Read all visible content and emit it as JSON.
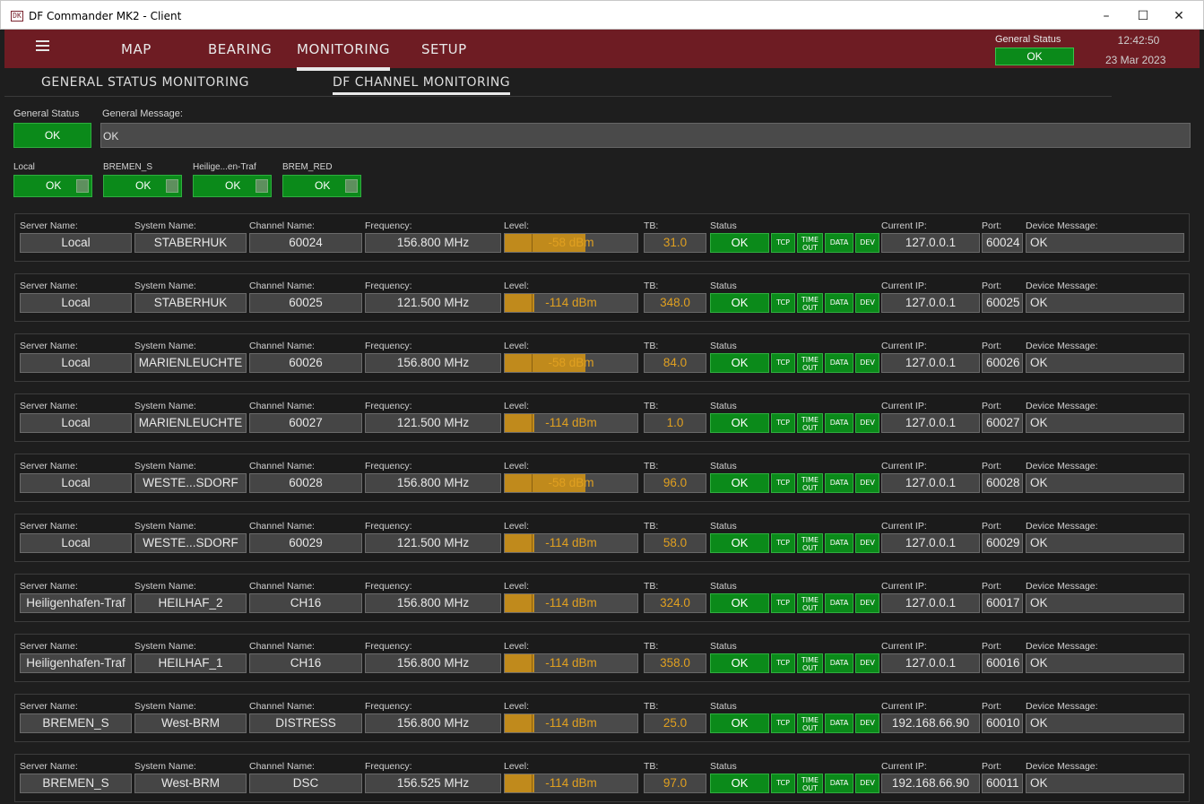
{
  "window": {
    "title": "DF Commander MK2 - Client",
    "icon_text": "DK"
  },
  "nav": {
    "items": [
      "MAP",
      "BEARING",
      "MONITORING",
      "SETUP"
    ],
    "active": "MONITORING"
  },
  "header_status": {
    "label": "General Status",
    "value": "OK",
    "time": "12:42:50",
    "date": "23 Mar 2023"
  },
  "subtabs": {
    "general": "GENERAL STATUS MONITORING",
    "channel": "DF CHANNEL MONITORING"
  },
  "general": {
    "status_label": "General Status",
    "status_value": "OK",
    "message_label": "General Message:",
    "message_value": "OK"
  },
  "servers": [
    {
      "name": "Local",
      "status": "OK"
    },
    {
      "name": "BREMEN_S",
      "status": "OK"
    },
    {
      "name": "Heilige...en-Traf",
      "status": "OK"
    },
    {
      "name": "BREM_RED",
      "status": "OK"
    }
  ],
  "labels": {
    "server": "Server Name:",
    "system": "System Name:",
    "channel": "Channel Name:",
    "frequency": "Frequency:",
    "level": "Level:",
    "tb": "TB:",
    "status": "Status",
    "ip": "Current IP:",
    "port": "Port:",
    "device": "Device Message:"
  },
  "flags": {
    "tcp": "TCP",
    "timeout_1": "TIME",
    "timeout_2": "OUT",
    "data": "DATA",
    "dev": "DEV"
  },
  "colors": {
    "title_bar": "#6e1c23",
    "ok_green": "#0b8a1a",
    "level_amber": "#c08a1c",
    "level_text": "#e0a020"
  },
  "channels": [
    {
      "server": "Local",
      "system": "STABERHUK",
      "channel": "60024",
      "frequency": "156.800 MHz",
      "level": "-58 dBm",
      "level_pct": 61,
      "tb": "31.0",
      "status": "OK",
      "ip": "127.0.0.1",
      "port": "60024",
      "message": "OK"
    },
    {
      "server": "Local",
      "system": "STABERHUK",
      "channel": "60025",
      "frequency": "121.500 MHz",
      "level": "-114 dBm",
      "level_pct": 22,
      "tb": "348.0",
      "status": "OK",
      "ip": "127.0.0.1",
      "port": "60025",
      "message": "OK"
    },
    {
      "server": "Local",
      "system": "MARIENLEUCHTE",
      "channel": "60026",
      "frequency": "156.800 MHz",
      "level": "-58 dBm",
      "level_pct": 61,
      "tb": "84.0",
      "status": "OK",
      "ip": "127.0.0.1",
      "port": "60026",
      "message": "OK"
    },
    {
      "server": "Local",
      "system": "MARIENLEUCHTE",
      "channel": "60027",
      "frequency": "121.500 MHz",
      "level": "-114 dBm",
      "level_pct": 22,
      "tb": "1.0",
      "status": "OK",
      "ip": "127.0.0.1",
      "port": "60027",
      "message": "OK"
    },
    {
      "server": "Local",
      "system": "WESTE...SDORF",
      "channel": "60028",
      "frequency": "156.800 MHz",
      "level": "-58 dBm",
      "level_pct": 61,
      "tb": "96.0",
      "status": "OK",
      "ip": "127.0.0.1",
      "port": "60028",
      "message": "OK"
    },
    {
      "server": "Local",
      "system": "WESTE...SDORF",
      "channel": "60029",
      "frequency": "121.500 MHz",
      "level": "-114 dBm",
      "level_pct": 22,
      "tb": "58.0",
      "status": "OK",
      "ip": "127.0.0.1",
      "port": "60029",
      "message": "OK"
    },
    {
      "server": "Heiligenhafen-Traf",
      "system": "HEILHAF_2",
      "channel": "CH16",
      "frequency": "156.800 MHz",
      "level": "-114 dBm",
      "level_pct": 22,
      "tb": "324.0",
      "status": "OK",
      "ip": "127.0.0.1",
      "port": "60017",
      "message": "OK"
    },
    {
      "server": "Heiligenhafen-Traf",
      "system": "HEILHAF_1",
      "channel": "CH16",
      "frequency": "156.800 MHz",
      "level": "-114 dBm",
      "level_pct": 22,
      "tb": "358.0",
      "status": "OK",
      "ip": "127.0.0.1",
      "port": "60016",
      "message": "OK"
    },
    {
      "server": "BREMEN_S",
      "system": "West-BRM",
      "channel": "DISTRESS",
      "frequency": "156.800 MHz",
      "level": "-114 dBm",
      "level_pct": 22,
      "tb": "25.0",
      "status": "OK",
      "ip": "192.168.66.90",
      "port": "60010",
      "message": "OK"
    },
    {
      "server": "BREMEN_S",
      "system": "West-BRM",
      "channel": "DSC",
      "frequency": "156.525 MHz",
      "level": "-114 dBm",
      "level_pct": 22,
      "tb": "97.0",
      "status": "OK",
      "ip": "192.168.66.90",
      "port": "60011",
      "message": "OK"
    }
  ]
}
